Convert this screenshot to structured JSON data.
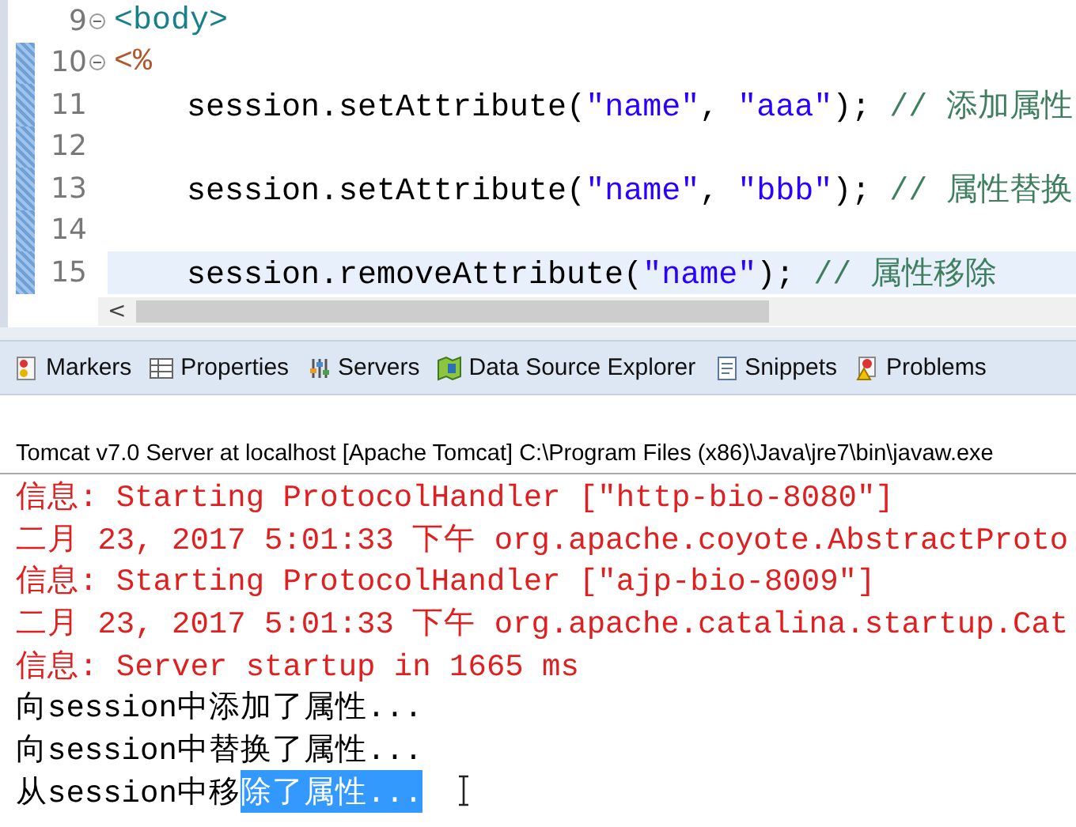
{
  "editor": {
    "lines": [
      {
        "number": "9",
        "foldable": true,
        "changed": false,
        "selected": false,
        "tokens": [
          {
            "kind": "tag",
            "text": "<body>"
          }
        ]
      },
      {
        "number": "10",
        "foldable": true,
        "changed": true,
        "selected": false,
        "tokens": [
          {
            "kind": "scriptlet",
            "text": "<%"
          }
        ]
      },
      {
        "number": "11",
        "foldable": false,
        "changed": true,
        "selected": false,
        "tokens": [
          {
            "kind": "code",
            "text": "    session.setAttribute("
          },
          {
            "kind": "string",
            "text": "\"name\""
          },
          {
            "kind": "code",
            "text": ", "
          },
          {
            "kind": "string",
            "text": "\"aaa\""
          },
          {
            "kind": "code",
            "text": "); "
          },
          {
            "kind": "comment",
            "text": "// 添加属性"
          }
        ]
      },
      {
        "number": "12",
        "foldable": false,
        "changed": true,
        "selected": false
      },
      {
        "number": "13",
        "foldable": false,
        "changed": true,
        "selected": false,
        "tokens": [
          {
            "kind": "code",
            "text": "    session.setAttribute("
          },
          {
            "kind": "string",
            "text": "\"name\""
          },
          {
            "kind": "code",
            "text": ", "
          },
          {
            "kind": "string",
            "text": "\"bbb\""
          },
          {
            "kind": "code",
            "text": "); "
          },
          {
            "kind": "comment",
            "text": "// 属性替换"
          }
        ]
      },
      {
        "number": "14",
        "foldable": false,
        "changed": true,
        "selected": false
      },
      {
        "number": "15",
        "foldable": false,
        "changed": true,
        "selected": true,
        "tokens": [
          {
            "kind": "code",
            "text": "    session.removeAttribute("
          },
          {
            "kind": "string",
            "text": "\"name\""
          },
          {
            "kind": "code",
            "text": "); "
          },
          {
            "kind": "comment",
            "text": "// 属性移除"
          }
        ]
      }
    ],
    "scroll_arrow": "<"
  },
  "tabs": [
    {
      "label": "Markers",
      "selected": false
    },
    {
      "label": "Properties",
      "selected": false
    },
    {
      "label": "Servers",
      "selected": false
    },
    {
      "label": "Data Source Explorer",
      "selected": false
    },
    {
      "label": "Snippets",
      "selected": false
    },
    {
      "label": "Problems",
      "selected": false
    }
  ],
  "console": {
    "title": "Tomcat v7.0 Server at localhost [Apache Tomcat] C:\\Program Files (x86)\\Java\\jre7\\bin\\javaw.exe",
    "lines": [
      {
        "kind": "err",
        "parts": [
          {
            "text": "信息: Starting ProtocolHandler [\"http-bio-8080\"]",
            "selected": false
          }
        ]
      },
      {
        "kind": "err",
        "parts": [
          {
            "text": "二月 23, 2017 5:01:33 下午 org.apache.coyote.AbstractProto",
            "selected": false
          }
        ]
      },
      {
        "kind": "err",
        "parts": [
          {
            "text": "信息: Starting ProtocolHandler [\"ajp-bio-8009\"]",
            "selected": false
          }
        ]
      },
      {
        "kind": "err",
        "parts": [
          {
            "text": "二月 23, 2017 5:01:33 下午 org.apache.catalina.startup.Cat",
            "selected": false
          }
        ]
      },
      {
        "kind": "err",
        "parts": [
          {
            "text": "信息: Server startup in 1665 ms",
            "selected": false
          }
        ]
      },
      {
        "kind": "out",
        "parts": [
          {
            "text": "向session中添加了属性...",
            "selected": false
          }
        ]
      },
      {
        "kind": "out",
        "parts": [
          {
            "text": "向session中替换了属性...",
            "selected": false
          }
        ]
      },
      {
        "kind": "out",
        "parts": [
          {
            "text": "从session中移",
            "selected": false
          },
          {
            "text": "除了属性...",
            "selected": true
          }
        ]
      }
    ]
  }
}
